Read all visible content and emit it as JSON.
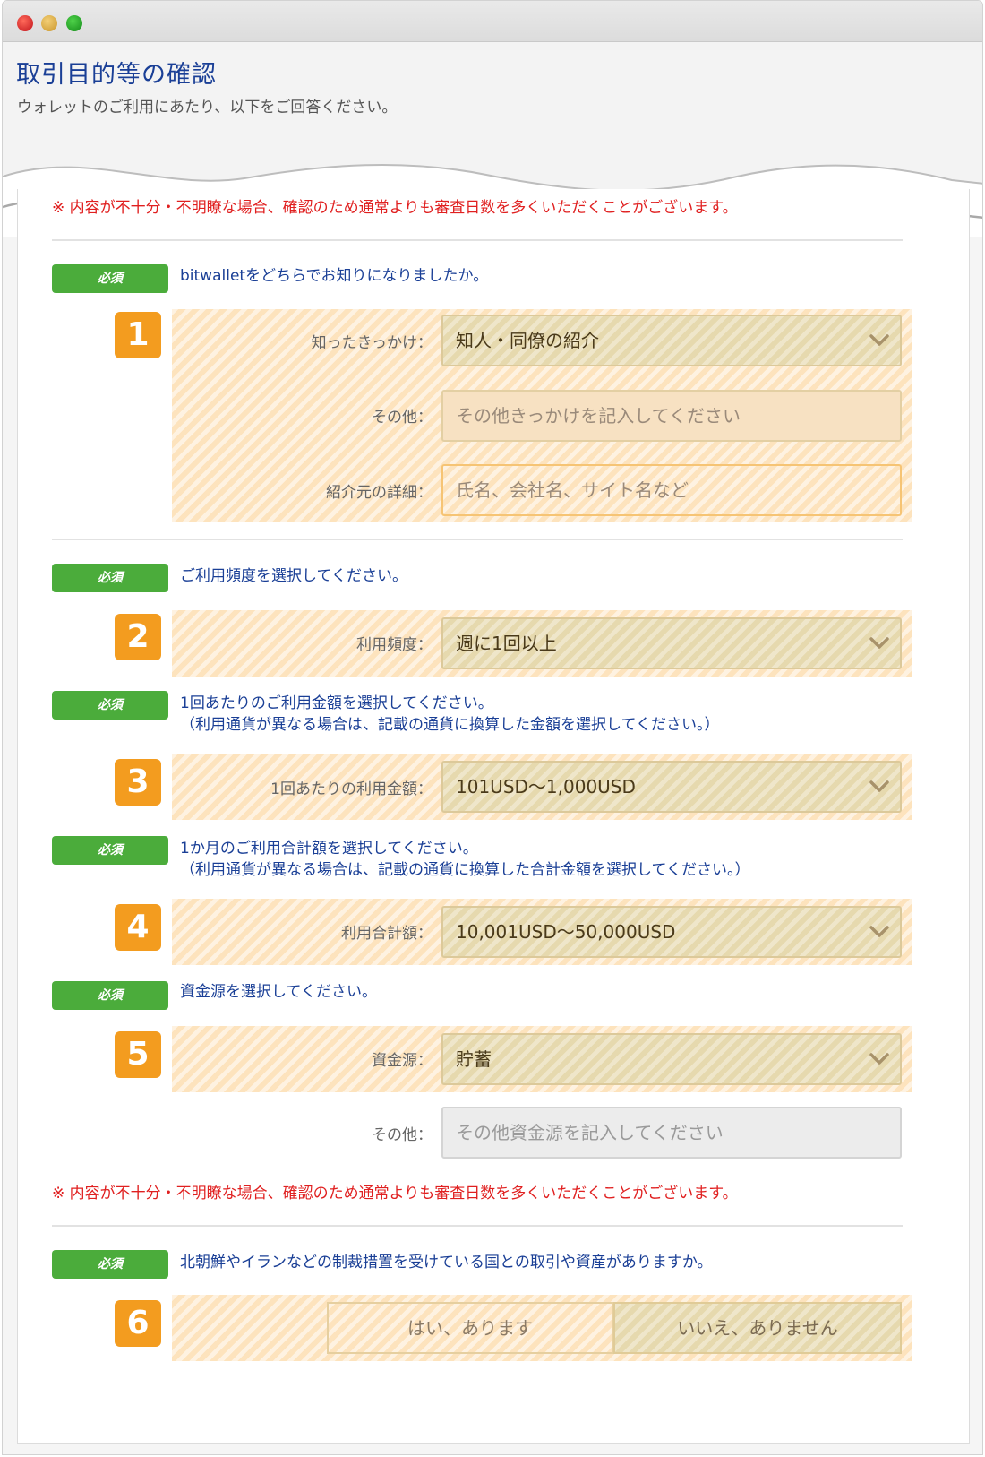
{
  "window": {
    "controls": [
      "close",
      "minimize",
      "zoom"
    ]
  },
  "header": {
    "title": "取引目的等の確認",
    "subtitle": "ウォレットのご利用にあたり、以下をご回答ください。"
  },
  "notice": "※ 内容が不十分・不明瞭な場合、確認のため通常よりも審査日数を多くいただくことがございます。",
  "required_label": "必須",
  "q1": {
    "number": "1",
    "question": "bitwalletをどちらでお知りになりましたか。",
    "trigger_label": "知ったきっかけ：",
    "trigger_value": "知人・同僚の紹介",
    "other_label": "その他：",
    "other_placeholder": "その他きっかけを記入してください",
    "details_label": "紹介元の詳細：",
    "details_placeholder": "氏名、会社名、サイト名など"
  },
  "q2": {
    "number": "2",
    "question": "ご利用頻度を選択してください。",
    "label": "利用頻度：",
    "value": "週に1回以上"
  },
  "q3": {
    "number": "3",
    "question_line1": "1回あたりのご利用金額を選択してください。",
    "question_line2": "（利用通貨が異なる場合は、記載の通貨に換算した金額を選択してください。）",
    "label": "1回あたりの利用金額：",
    "value": "101USD〜1,000USD"
  },
  "q4": {
    "number": "4",
    "question_line1": "1か月のご利用合計額を選択してください。",
    "question_line2": "（利用通貨が異なる場合は、記載の通貨に換算した合計金額を選択してください。）",
    "label": "利用合計額：",
    "value": "10,001USD〜50,000USD"
  },
  "q5": {
    "number": "5",
    "question": "資金源を選択してください。",
    "label": "資金源：",
    "value": "貯蓄",
    "other_label": "その他：",
    "other_placeholder": "その他資金源を記入してください"
  },
  "q6": {
    "number": "6",
    "question": "北朝鮮やイランなどの制裁措置を受けている国との取引や資産がありますか。",
    "yes_label": "はい、あります",
    "no_label": "いいえ、ありません",
    "selected": "no"
  },
  "colors": {
    "title": "#1a3f96",
    "notice": "#e02020",
    "badge": "#4bac3b",
    "number_box": "#f39c1f",
    "panel": "#fde3bd",
    "select": "#e6d9ae"
  },
  "icons": {
    "dropdown": "chevron-down-icon"
  }
}
